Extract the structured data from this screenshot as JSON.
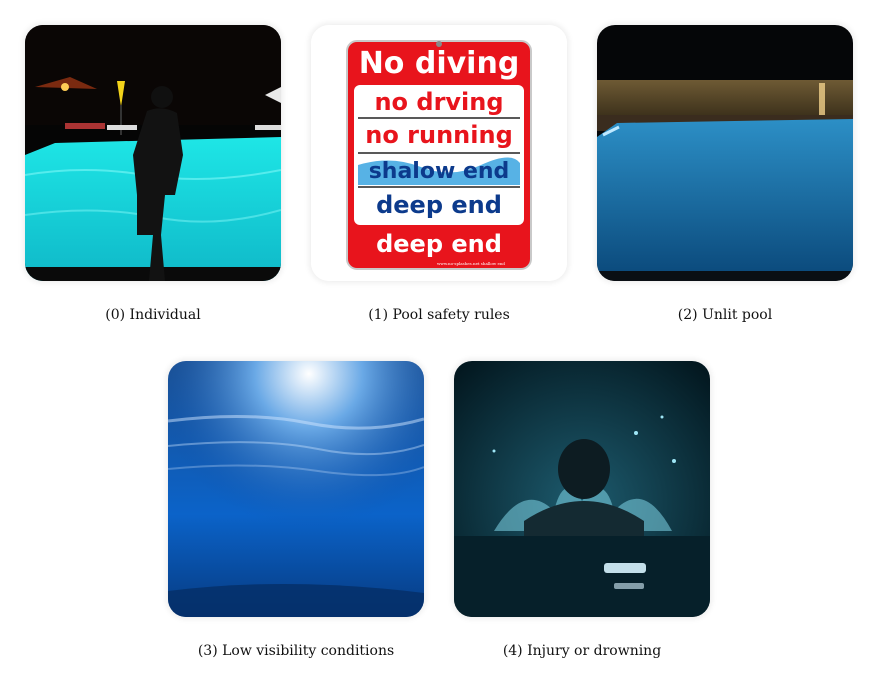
{
  "panels": [
    {
      "index": "(0)",
      "caption": "(0) Individual",
      "image": "person-by-lit-pool-at-night"
    },
    {
      "index": "(1)",
      "caption": "(1) Pool safety rules",
      "image": "pool-safety-sign"
    },
    {
      "index": "(2)",
      "caption": "(2) Unlit pool",
      "image": "dark-pool-at-night"
    },
    {
      "index": "(3)",
      "caption": "(3) Low visibility conditions",
      "image": "murky-underwater-view"
    },
    {
      "index": "(4)",
      "caption": "(4) Injury or drowning",
      "image": "person-struggling-in-water"
    }
  ],
  "sign": {
    "line1": "No diving",
    "line2": "no drving",
    "line3": "no running",
    "line4": "shalow end",
    "line5": "deep end",
    "line6": "deep end",
    "footer": "www.no-splashes.net shallow end",
    "colors": {
      "red": "#e8141c",
      "blue": "#0c3a8c",
      "white": "#ffffff"
    }
  }
}
